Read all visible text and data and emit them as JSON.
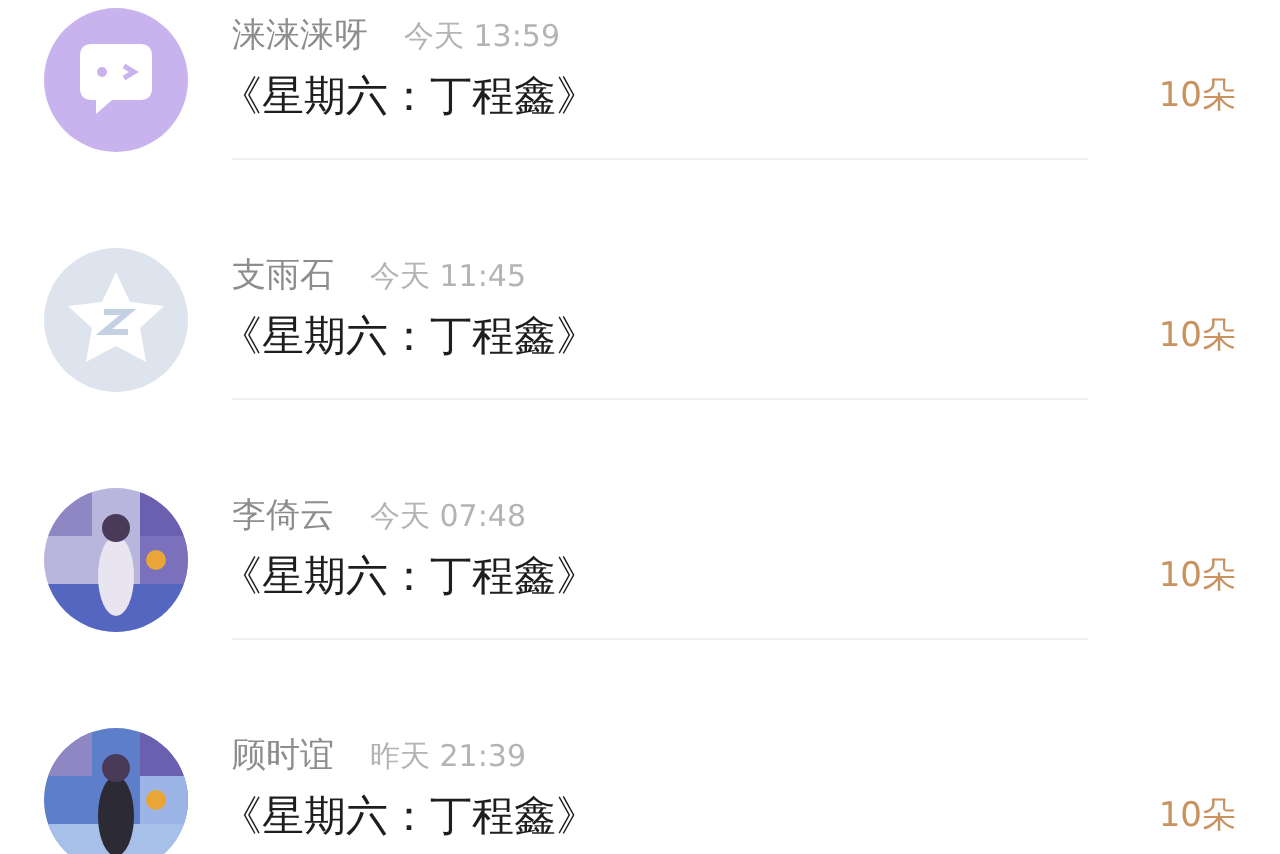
{
  "messages": [
    {
      "avatar": {
        "kind": "chat"
      },
      "name": "涞涞涞呀",
      "time": "今天 13:59",
      "title": "《星期六：丁程鑫》",
      "count": "10朵"
    },
    {
      "avatar": {
        "kind": "star"
      },
      "name": "支雨石",
      "time": "今天 11:45",
      "title": "《星期六：丁程鑫》",
      "count": "10朵"
    },
    {
      "name": "李倚云",
      "time": "今天 07:48",
      "title": "《星期六：丁程鑫》",
      "count": "10朵"
    },
    {
      "name": "顾时谊",
      "time": "昨天 21:39",
      "title": "《星期六：丁程鑫》",
      "count": "10朵"
    }
  ]
}
